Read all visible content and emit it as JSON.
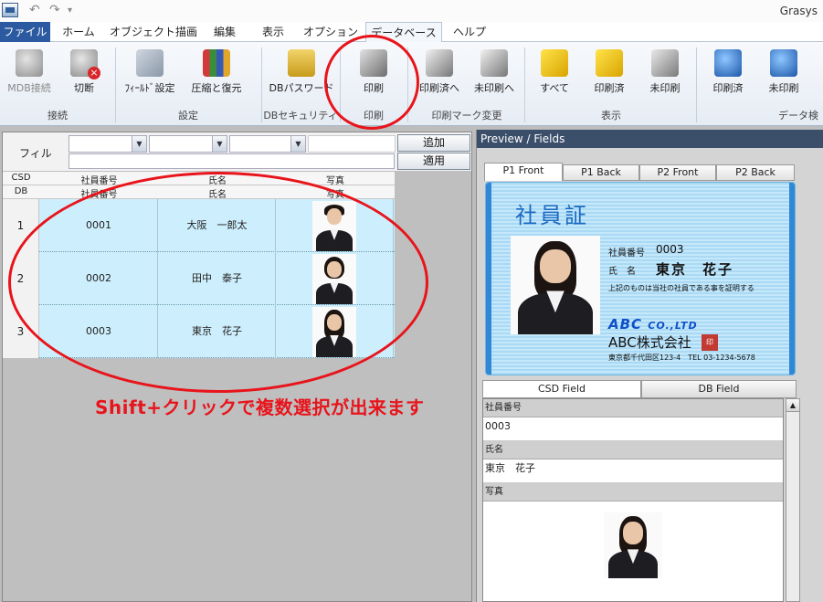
{
  "app": {
    "title": "Grasys"
  },
  "ribbon": {
    "tabs": [
      "ファイル",
      "ホーム",
      "オブジェクト描画",
      "編集",
      "表示",
      "オプション",
      "データベース",
      "ヘルプ"
    ],
    "active_tab": "データベース",
    "buttons": {
      "mdb_connect": "MDB接続",
      "disconnect": "切断",
      "field_settings": "ﾌｨｰﾙﾄﾞ設定",
      "compress_restore": "圧縮と復元",
      "db_password": "DBパスワード",
      "print": "印刷",
      "mark_printed": "印刷済へ",
      "mark_unprinted": "未印刷へ",
      "show_all": "すべて",
      "show_printed": "印刷済",
      "show_unprinted": "未印刷",
      "search_printed": "印刷済",
      "search_unprinted": "未印刷"
    },
    "groups": {
      "connection": "接続",
      "settings": "設定",
      "db_security": "DBセキュリティ",
      "print": "印刷",
      "print_mark_change": "印刷マーク変更",
      "display": "表示",
      "data_search": "データ検"
    }
  },
  "annotation": {
    "text": "Shift+クリックで複数選択が出来ます"
  },
  "left_panel": {
    "filter_label": "フィル",
    "add_button": "追加",
    "apply_button": "適用",
    "grid": {
      "row_csd_label": "CSD",
      "row_db_label": "DB",
      "columns": [
        "社員番号",
        "氏名",
        "写真"
      ],
      "rows": [
        {
          "num": "1",
          "id": "0001",
          "name": "大阪　一郎太"
        },
        {
          "num": "2",
          "id": "0002",
          "name": "田中　泰子"
        },
        {
          "num": "3",
          "id": "0003",
          "name": "東京　花子"
        }
      ]
    }
  },
  "right_panel": {
    "title": "Preview / Fields",
    "preview_tabs": [
      "P1 Front",
      "P1 Back",
      "P2 Front",
      "P2 Back"
    ],
    "active_preview_tab": "P1 Front",
    "card": {
      "heading": "社員証",
      "id_label": "社員番号",
      "id_value": "0003",
      "name_label": "氏　名",
      "name_value": "東京　花子",
      "note": "上記のものは当社の社員である事を証明する",
      "logo_main": "ABC",
      "logo_suffix": "CO.,LTD",
      "company": "ABC株式会社",
      "seal": "印",
      "address": "東京都千代田区123-4　TEL 03-1234-5678"
    },
    "field_tabs": [
      "CSD Field",
      "DB Field"
    ],
    "fields": [
      {
        "label": "社員番号",
        "value": "0003"
      },
      {
        "label": "氏名",
        "value": "東京　花子"
      },
      {
        "label": "写真",
        "value": ""
      }
    ]
  },
  "colors": {
    "accent": "#2b5aa0",
    "annotation": "#e8141b",
    "row_selected": "#cdeefc",
    "card_blue": "#1a69c2"
  }
}
